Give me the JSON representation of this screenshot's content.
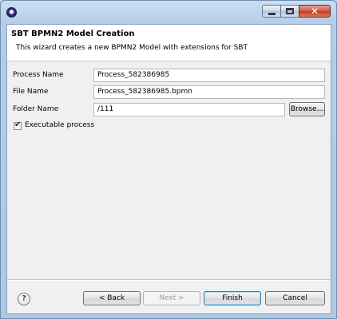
{
  "window": {
    "close_glyph": "✕"
  },
  "banner": {
    "title": "SBT BPMN2 Model Creation",
    "description": "This wizard creates a new BPMN2 Model with extensions for SBT"
  },
  "form": {
    "process_name_label": "Process Name",
    "process_name_value": "Process_582386985",
    "file_name_label": "File Name",
    "file_name_value": "Process_582386985.bpmn",
    "folder_name_label": "Folder Name",
    "folder_name_value": "/111",
    "browse_label": "Browse...",
    "executable_label": "Executable process",
    "executable_checked": true
  },
  "footer": {
    "help_glyph": "?",
    "back_label": "< Back",
    "next_label": "Next >",
    "finish_label": "Finish",
    "cancel_label": "Cancel"
  },
  "icons": {
    "app": "eclipse-icon",
    "help": "help-icon",
    "check": "checkmark-icon"
  }
}
